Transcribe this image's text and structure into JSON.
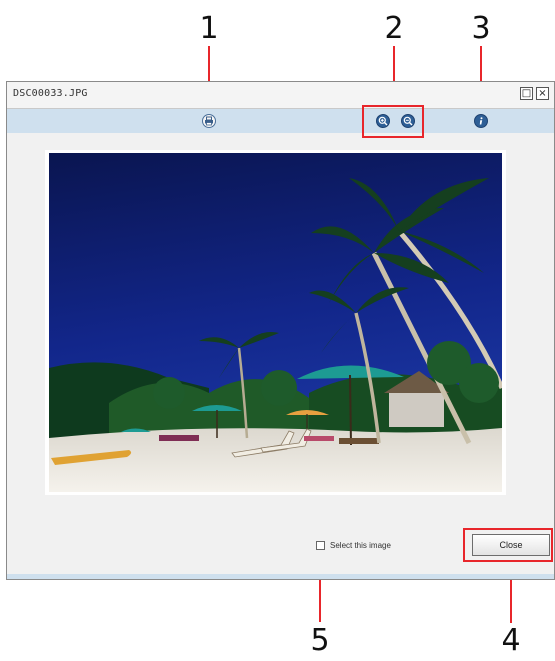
{
  "window": {
    "title": "DSC00033.JPG",
    "restore_glyph": "□",
    "close_glyph": "×"
  },
  "toolbar": {
    "icons": [
      "print-icon",
      "zoom-in-icon",
      "zoom-out-icon",
      "info-icon"
    ]
  },
  "footer": {
    "select_label": "Select this image",
    "close_label": "Close"
  },
  "callouts": [
    "1",
    "2",
    "3",
    "4",
    "5"
  ],
  "colors": {
    "highlight": "#e8262b",
    "toolbar_bg": "#cfe0ee",
    "window_bg": "#f1f1f1"
  }
}
